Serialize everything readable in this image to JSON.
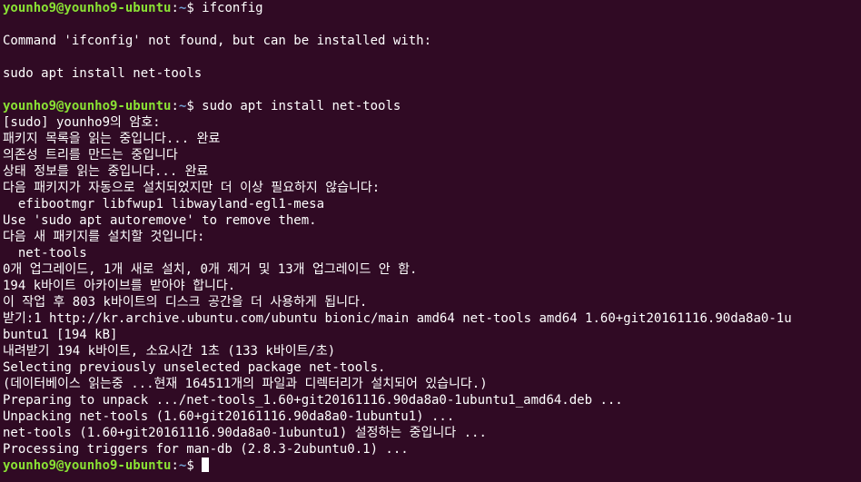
{
  "terminal": {
    "prompt": {
      "user_host": "younho9@younho9-ubuntu",
      "separator": ":",
      "path": "~",
      "symbol": "$ "
    },
    "lines": {
      "l01": "ifconfig",
      "l02": "",
      "l03": "Command 'ifconfig' not found, but can be installed with:",
      "l04": "",
      "l05": "sudo apt install net-tools",
      "l06": "",
      "l07": "sudo apt install net-tools",
      "l08": "[sudo] younho9의 암호:",
      "l09": "패키지 목록을 읽는 중입니다... 완료",
      "l10": "의존성 트리를 만드는 중입니다",
      "l11": "상태 정보를 읽는 중입니다... 완료",
      "l12": "다음 패키지가 자동으로 설치되었지만 더 이상 필요하지 않습니다:",
      "l13": "  efibootmgr libfwup1 libwayland-egl1-mesa",
      "l14": "Use 'sudo apt autoremove' to remove them.",
      "l15": "다음 새 패키지를 설치할 것입니다:",
      "l16": "  net-tools",
      "l17": "0개 업그레이드, 1개 새로 설치, 0개 제거 및 13개 업그레이드 안 함.",
      "l18": "194 k바이트 아카이브를 받아야 합니다.",
      "l19": "이 작업 후 803 k바이트의 디스크 공간을 더 사용하게 됩니다.",
      "l20": "받기:1 http://kr.archive.ubuntu.com/ubuntu bionic/main amd64 net-tools amd64 1.60+git20161116.90da8a0-1u",
      "l20b": "buntu1 [194 kB]",
      "l21": "내려받기 194 k바이트, 소요시간 1초 (133 k바이트/초)",
      "l22": "Selecting previously unselected package net-tools.",
      "l23": "(데이터베이스 읽는중 ...현재 164511개의 파일과 디렉터리가 설치되어 있습니다.)",
      "l24": "Preparing to unpack .../net-tools_1.60+git20161116.90da8a0-1ubuntu1_amd64.deb ...",
      "l25": "Unpacking net-tools (1.60+git20161116.90da8a0-1ubuntu1) ...",
      "l26": "net-tools (1.60+git20161116.90da8a0-1ubuntu1) 설정하는 중입니다 ...",
      "l27": "Processing triggers for man-db (2.8.3-2ubuntu0.1) ..."
    }
  },
  "colors": {
    "background": "#300a24",
    "text": "#ffffff",
    "prompt_user": "#8ae234",
    "prompt_path": "#729fcf"
  }
}
